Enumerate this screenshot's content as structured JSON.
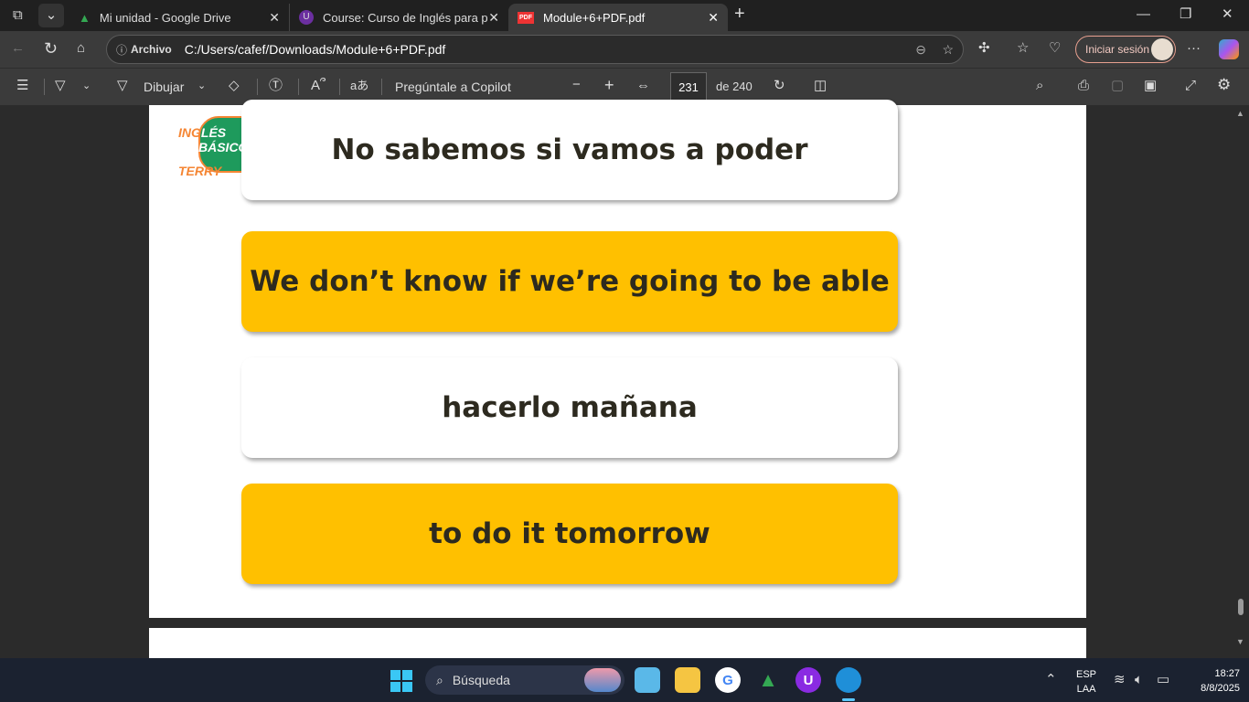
{
  "tabs": [
    {
      "title": "Mi unidad - Google Drive"
    },
    {
      "title": "Course: Curso de Inglés para princ"
    },
    {
      "title": "Module+6+PDF.pdf",
      "active": true
    }
  ],
  "address": {
    "label": "Archivo",
    "url": "C:/Users/cafef/Downloads/Module+6+PDF.pdf"
  },
  "signin": "Iniciar sesión",
  "pdf_toolbar": {
    "draw": "Dibujar",
    "copilot": "Pregúntale a Copilot",
    "page": "231",
    "of": "de 240"
  },
  "logo": {
    "line1": "INGLÉS",
    "line2": "BÁSICO",
    "line3": "TERRY"
  },
  "cards": [
    {
      "text": "No sabemos si vamos a poder",
      "color": "white"
    },
    {
      "text": "We don’t know if  we’re going to be able",
      "color": "yellow"
    },
    {
      "text": "hacerlo mañana",
      "color": "white"
    },
    {
      "text": "to do it tomorrow",
      "color": "yellow"
    }
  ],
  "taskbar": {
    "search": "Búsqueda",
    "lang1": "ESP",
    "lang2": "LAA",
    "time": "18:27",
    "date": "8/8/2025"
  },
  "colors": {
    "accent_yellow": "#ffc000",
    "logo_green": "#1e9a5c",
    "logo_orange": "#f58634"
  }
}
